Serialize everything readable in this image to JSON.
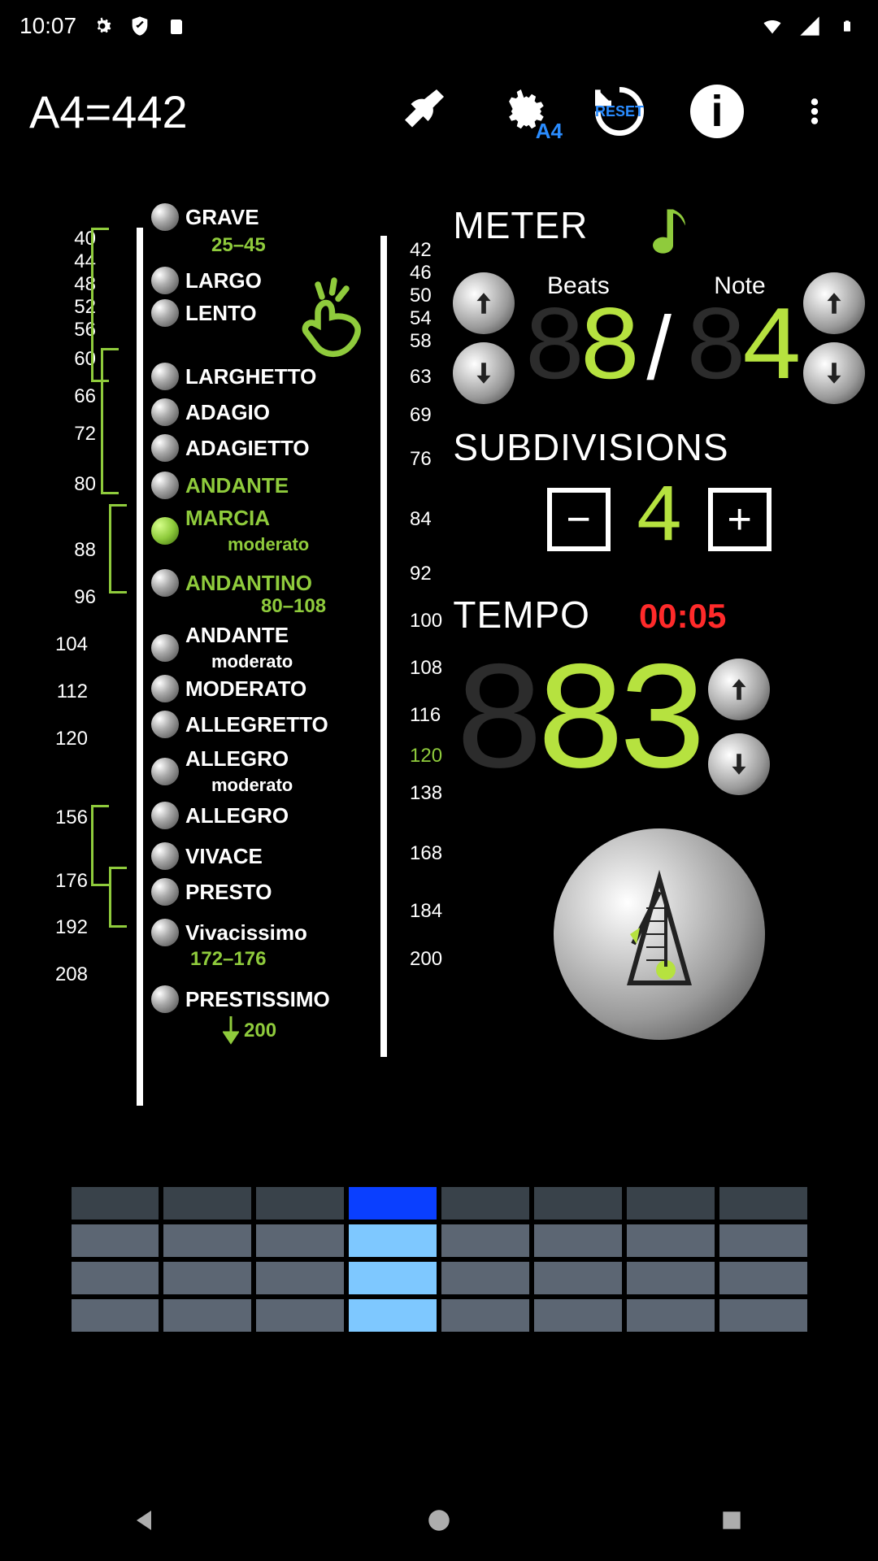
{
  "status": {
    "time": "10:07"
  },
  "toolbar": {
    "title": "A4=442"
  },
  "scale": {
    "left_ticks": [
      40,
      44,
      48,
      52,
      56,
      60,
      66,
      72,
      80,
      88,
      96,
      104,
      112,
      120,
      156,
      176,
      192,
      208
    ],
    "right_ticks": [
      42,
      46,
      50,
      54,
      58,
      63,
      69,
      76,
      84,
      92,
      100,
      108,
      116,
      120,
      138,
      168,
      184,
      200
    ],
    "markings": [
      {
        "label": "GRAVE",
        "range": "25–45",
        "active": false
      },
      {
        "label": "LARGO",
        "active": false
      },
      {
        "label": "LENTO",
        "active": false
      },
      {
        "label": "LARGHETTO",
        "active": false
      },
      {
        "label": "ADAGIO",
        "active": false
      },
      {
        "label": "ADAGIETTO",
        "active": false
      },
      {
        "label": "ANDANTE",
        "active_text": true
      },
      {
        "label": "MARCIA",
        "sub": "moderato",
        "active": true,
        "active_text": true
      },
      {
        "label": "ANDANTINO",
        "range": "80–108",
        "active_text": true
      },
      {
        "label": "ANDANTE",
        "sub": "moderato",
        "active": false
      },
      {
        "label": "MODERATO",
        "active": false
      },
      {
        "label": "ALLEGRETTO",
        "active": false
      },
      {
        "label": "ALLEGRO",
        "sub": "moderato",
        "active": false
      },
      {
        "label": "ALLEGRO",
        "active": false
      },
      {
        "label": "VIVACE",
        "active": false
      },
      {
        "label": "PRESTO",
        "active": false
      },
      {
        "label": "Vivacissimo",
        "range": "172–176",
        "active": false
      },
      {
        "label": "PRESTISSIMO",
        "active": false
      }
    ],
    "bottom_arrow": "200"
  },
  "meter": {
    "title": "METER",
    "beats_label": "Beats",
    "note_label": "Note",
    "beats": "8",
    "note": "4"
  },
  "subdivisions": {
    "title": "SUBDIVISIONS",
    "value": "4"
  },
  "tempo": {
    "title": "TEMPO",
    "timer": "00:05",
    "value": "83"
  },
  "beatgrid": {
    "rows": 4,
    "cols": 8,
    "active_col": 3
  }
}
